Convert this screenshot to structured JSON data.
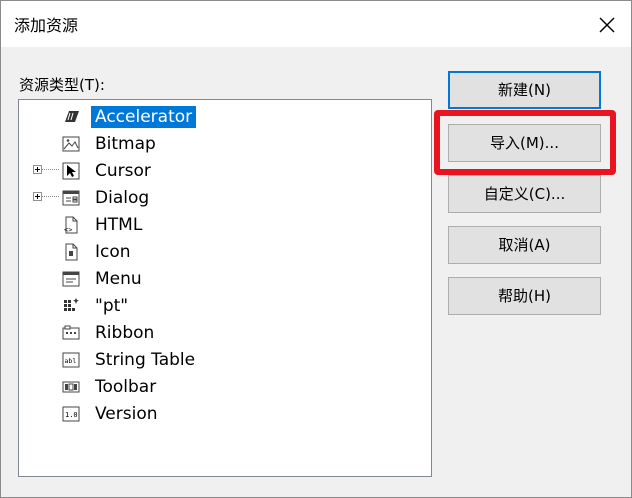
{
  "window": {
    "title": "添加资源"
  },
  "tree_label": "资源类型(T):",
  "resource_types": [
    {
      "label": "Accelerator",
      "icon": "accelerator-icon",
      "selected": true,
      "expandable": false
    },
    {
      "label": "Bitmap",
      "icon": "bitmap-icon",
      "selected": false,
      "expandable": false
    },
    {
      "label": "Cursor",
      "icon": "cursor-icon",
      "selected": false,
      "expandable": true
    },
    {
      "label": "Dialog",
      "icon": "dialog-icon",
      "selected": false,
      "expandable": true
    },
    {
      "label": "HTML",
      "icon": "html-icon",
      "selected": false,
      "expandable": false
    },
    {
      "label": "Icon",
      "icon": "icon-resource-icon",
      "selected": false,
      "expandable": false
    },
    {
      "label": "Menu",
      "icon": "menu-icon",
      "selected": false,
      "expandable": false
    },
    {
      "label": "\"pt\"",
      "icon": "custom-resource-icon",
      "selected": false,
      "expandable": false
    },
    {
      "label": "Ribbon",
      "icon": "ribbon-icon",
      "selected": false,
      "expandable": false
    },
    {
      "label": "String Table",
      "icon": "string-table-icon",
      "selected": false,
      "expandable": false
    },
    {
      "label": "Toolbar",
      "icon": "toolbar-icon",
      "selected": false,
      "expandable": false
    },
    {
      "label": "Version",
      "icon": "version-icon",
      "selected": false,
      "expandable": false
    }
  ],
  "buttons": {
    "new": "新建(N)",
    "import": "导入(M)...",
    "custom": "自定义(C)...",
    "cancel": "取消(A)",
    "help": "帮助(H)"
  },
  "colors": {
    "selection": "#0078d7",
    "highlight_box": "#e8141f"
  }
}
